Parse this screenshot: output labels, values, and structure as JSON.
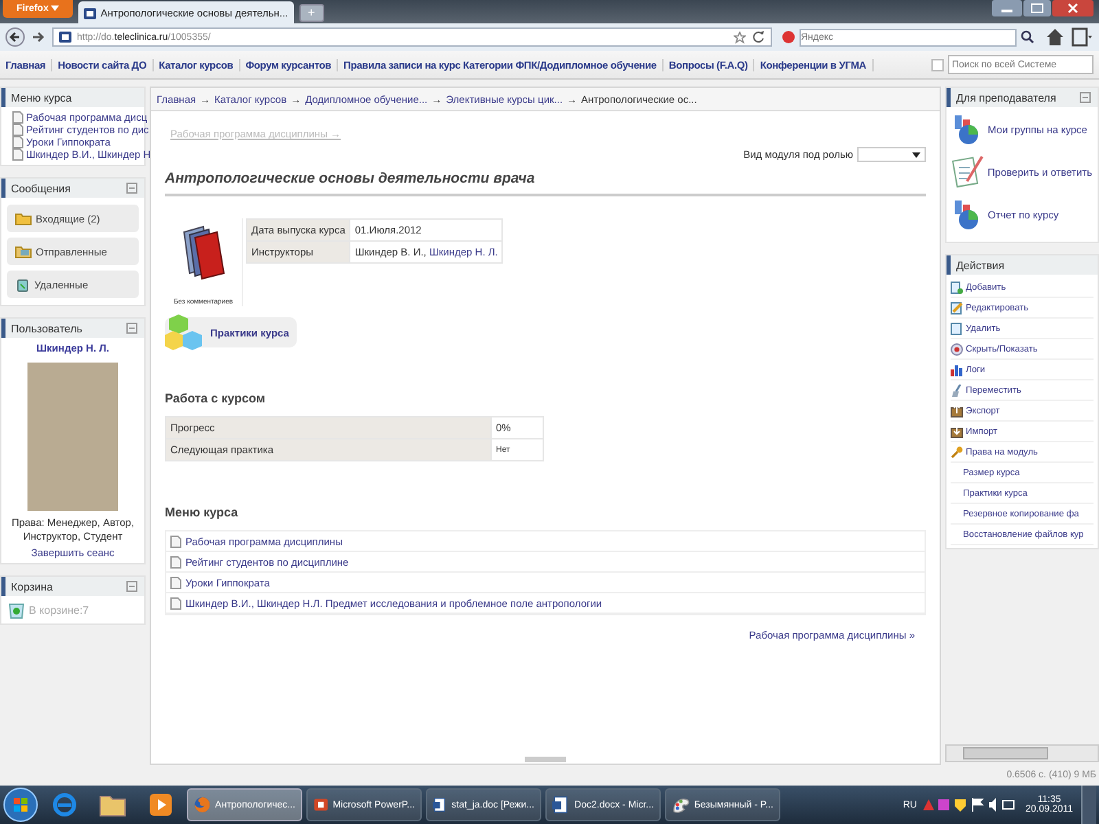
{
  "browser": {
    "menu_button": "Firefox",
    "tabs": [
      {
        "title": "Антропологические основы деятельн...",
        "selected": true
      }
    ],
    "new_tab": "+",
    "url_host": "http://do.",
    "url_domain": "teleclinica.ru",
    "url_path": "/1005355/",
    "search_placeholder": "Яндекс"
  },
  "site_nav": {
    "items": [
      "Главная",
      "Новости сайта ДО",
      "Каталог курсов",
      "Форум курсантов",
      "Правила записи на курс Категории ФПК/Додипломное обучение",
      "Вопросы (F.A.Q)",
      "Конференции в УГМА"
    ],
    "search_checked": false,
    "search_placeholder": "Поиск по всей Системе"
  },
  "left": {
    "course_menu": {
      "title": "Меню курса",
      "items": [
        "Рабочая программа дисц",
        "Рейтинг студентов по дис",
        "Уроки Гиппократа",
        "Шкиндер В.И., Шкиндер Н"
      ]
    },
    "messages": {
      "title": "Сообщения",
      "collapsible": true,
      "items": [
        {
          "label": "Входящие (2)",
          "kind": "inbox"
        },
        {
          "label": "Отправленные",
          "kind": "sent"
        },
        {
          "label": "Удаленные",
          "kind": "deleted"
        }
      ]
    },
    "user": {
      "title": "Пользователь",
      "collapsible": true,
      "name": "Шкиндер Н. Л.",
      "rights": "Права: Менеджер, Автор, Инструктор, Студент",
      "logout": "Завершить сеанс"
    },
    "trash": {
      "title": "Корзина",
      "collapsible": true,
      "text": "В корзине:7"
    }
  },
  "center": {
    "breadcrumb": [
      "Главная",
      "Каталог курсов",
      "Додипломное обучение...",
      "Элективные курсы цик...",
      "Антропологические ос..."
    ],
    "separator": "→",
    "prev_link": {
      "label": "Рабочая программа дисциплины →",
      "disabled": true
    },
    "role_label": "Вид модуля под ролью",
    "title": "Антропологические основы деятельности врача",
    "info": [
      {
        "label": "Дата выпуска курса",
        "parts": [
          {
            "text": "01.Июля.2012",
            "link": false
          }
        ]
      },
      {
        "label": "Инструкторы",
        "parts": [
          {
            "text": "Шкиндер В. И., ",
            "link": false
          },
          {
            "text": "Шкиндер Н. Л.",
            "link": true
          }
        ]
      }
    ],
    "no_comments": "Без комментариев",
    "practice_button": "Практики курса",
    "work_title": "Работа с курсом",
    "work_rows": [
      {
        "label": "Прогресс",
        "value": "0%"
      },
      {
        "label": "Следующая практика",
        "value": "Нет"
      }
    ],
    "menu_title": "Меню курса",
    "menu_items": [
      "Рабочая программа дисциплины",
      "Рейтинг студентов по дисциплине",
      "Уроки Гиппократа",
      "Шкиндер В.И., Шкиндер Н.Л. Предмет исследования и проблемное поле антропологии"
    ],
    "next_link": {
      "label": "Рабочая программа дисциплины »",
      "disabled": false
    }
  },
  "right": {
    "teacher": {
      "title": "Для преподавателя",
      "collapsible": true,
      "items": [
        {
          "label": "Мои группы на курсе",
          "kind": "chart"
        },
        {
          "label": "Проверить и ответить",
          "kind": "check"
        },
        {
          "label": "Отчет по курсу",
          "kind": "chart"
        }
      ]
    },
    "actions": {
      "title": "Действия",
      "items": [
        {
          "label": "Добавить",
          "kind": "add"
        },
        {
          "label": "Редактировать",
          "kind": "edit"
        },
        {
          "label": "Удалить",
          "kind": "delete"
        },
        {
          "label": "Скрыть/Показать",
          "kind": "eye"
        },
        {
          "label": "Логи",
          "kind": "bars"
        },
        {
          "label": "Переместить",
          "kind": "move"
        },
        {
          "label": "Экспорт",
          "kind": "export"
        },
        {
          "label": "Импорт",
          "kind": "import"
        },
        {
          "label": "Права на модуль",
          "kind": "key"
        },
        {
          "label": "Размер курса",
          "kind": "plain"
        },
        {
          "label": "Практики курса",
          "kind": "plain"
        },
        {
          "label": "Резервное копирование фа",
          "kind": "plain"
        },
        {
          "label": "Восстановление файлов кур",
          "kind": "plain"
        }
      ]
    }
  },
  "status_bar": "0.6506 с. (410) 9 МБ",
  "taskbar": {
    "pinned": [
      {
        "kind": "ie"
      },
      {
        "kind": "folder"
      },
      {
        "kind": "media"
      }
    ],
    "windows": [
      {
        "label": "Антропологичес...",
        "kind": "firefox",
        "selected": true
      },
      {
        "label": "Microsoft PowerP...",
        "kind": "ppt",
        "selected": false
      },
      {
        "label": "stat_ja.doc [Режи...",
        "kind": "word",
        "selected": false
      },
      {
        "label": "Doc2.docx - Micr...",
        "kind": "word",
        "selected": false
      },
      {
        "label": "Безымянный - P...",
        "kind": "paint",
        "selected": false
      }
    ],
    "language": "RU",
    "time": "11:35",
    "date": "20.09.2011"
  }
}
